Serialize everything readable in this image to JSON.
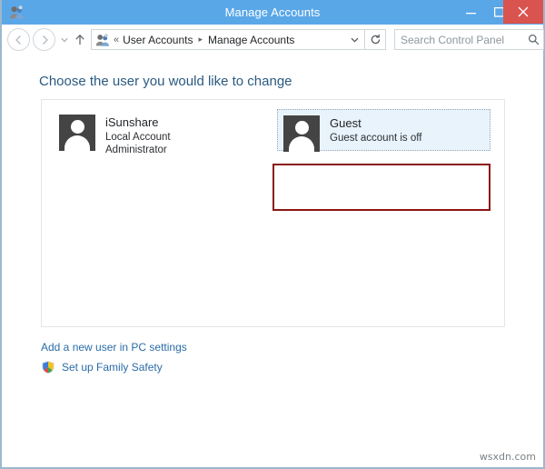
{
  "window": {
    "title": "Manage Accounts",
    "title_icon": "user-accounts-icon",
    "controls": {
      "minimize": "minimize-icon",
      "maximize": "maximize-icon",
      "close": "close-icon"
    },
    "colors": {
      "titlebar": "#5aa7e8",
      "close_button": "#d9534f",
      "frame_border": "#9db8cc",
      "heading_text": "#2b5a80",
      "link_text": "#2b6ca8",
      "annotation_red": "#8c1616",
      "selection_fill": "#e9f3fb",
      "avatar_bg": "#444444"
    }
  },
  "nav": {
    "back_label": "Back",
    "forward_label": "Forward",
    "recent_label": "Recent locations",
    "up_label": "Up",
    "breadcrumb": {
      "icon": "user-accounts-icon",
      "overflow": "«",
      "separator": "▸",
      "items": [
        {
          "label": "User Accounts"
        },
        {
          "label": "Manage Accounts"
        }
      ],
      "dropdown": "chevron-down-icon"
    },
    "refresh": "refresh-icon",
    "search": {
      "placeholder": "Search Control Panel",
      "value": "",
      "icon": "search-icon"
    }
  },
  "main": {
    "page_title": "Choose the user you would like to change",
    "accounts": [
      {
        "name": "iSunshare",
        "lines": [
          "Local Account",
          "Administrator"
        ],
        "avatar": "user-avatar-icon",
        "selected": false
      },
      {
        "name": "Guest",
        "lines": [
          "Guest account is off"
        ],
        "avatar": "user-avatar-icon",
        "selected": true
      }
    ],
    "links": [
      {
        "label": "Add a new user in PC settings",
        "icon": null
      },
      {
        "label": "Set up Family Safety",
        "icon": "shield-icon"
      }
    ]
  },
  "watermark": "wsxdn.com"
}
